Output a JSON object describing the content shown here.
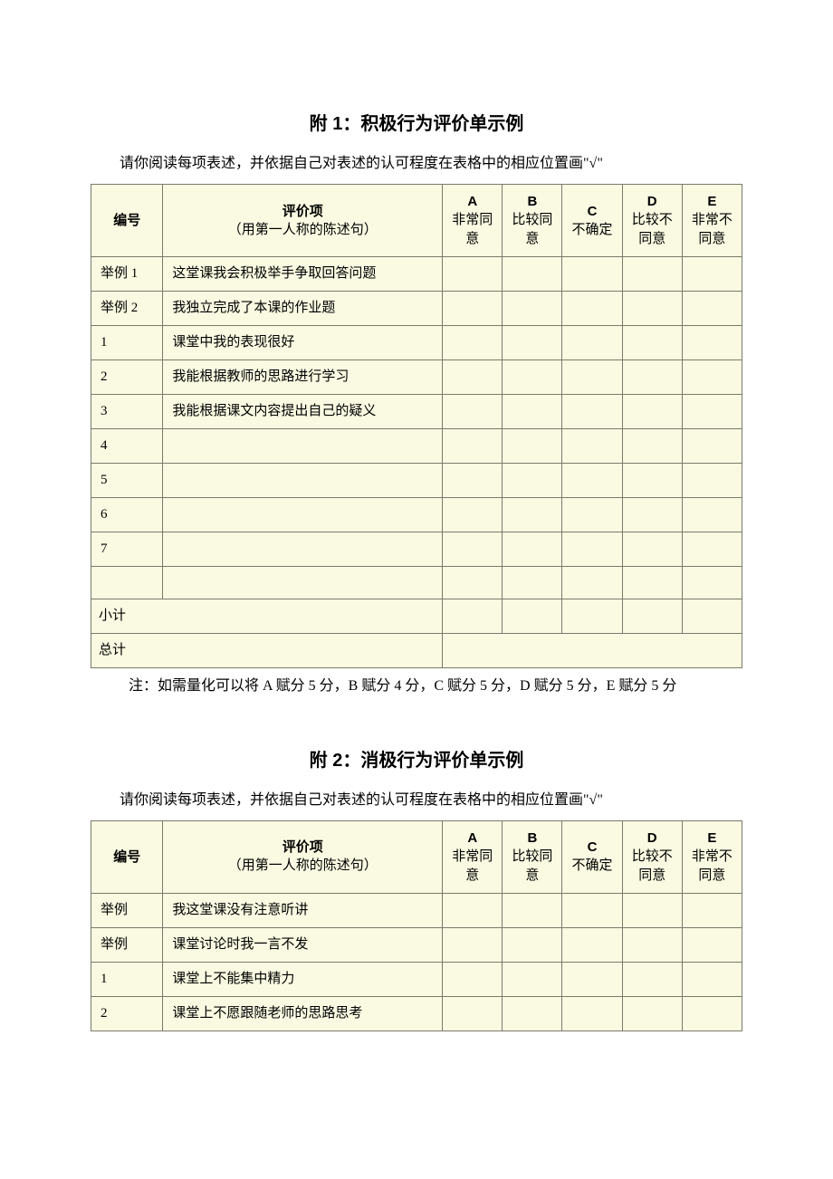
{
  "section1": {
    "title": "附 1：积极行为评价单示例",
    "intro": "请你阅读每项表述，并依据自己对表述的认可程度在表格中的相应位置画\"√\"",
    "headers": {
      "num": "编号",
      "item": "评价项",
      "item_sub": "（用第一人称的陈述句）",
      "a": "A",
      "a_sub": "非常同意",
      "b": "B",
      "b_sub": "比较同意",
      "c": "C",
      "c_sub": "不确定",
      "d": "D",
      "d_sub": "比较不同意",
      "e": "E",
      "e_sub": "非常不同意"
    },
    "rows": [
      {
        "num": "举例 1",
        "desc": "这堂课我会积极举手争取回答问题"
      },
      {
        "num": "举例 2",
        "desc": "我独立完成了本课的作业题"
      },
      {
        "num": "1",
        "desc": "课堂中我的表现很好"
      },
      {
        "num": "2",
        "desc": "我能根据教师的思路进行学习"
      },
      {
        "num": "3",
        "desc": "我能根据课文内容提出自己的疑义"
      },
      {
        "num": "4",
        "desc": ""
      },
      {
        "num": "5",
        "desc": ""
      },
      {
        "num": "6",
        "desc": ""
      },
      {
        "num": "7",
        "desc": ""
      },
      {
        "num": "",
        "desc": ""
      }
    ],
    "subtotal": "小计",
    "total": "总计",
    "note": "注：如需量化可以将 A 赋分 5 分，B 赋分 4 分，C 赋分 5 分，D 赋分 5 分，E 赋分 5 分"
  },
  "section2": {
    "title": "附 2：消极行为评价单示例",
    "intro": "请你阅读每项表述，并依据自己对表述的认可程度在表格中的相应位置画\"√\"",
    "headers": {
      "num": "编号",
      "item": "评价项",
      "item_sub": "（用第一人称的陈述句）",
      "a": "A",
      "a_sub": "非常同意",
      "b": "B",
      "b_sub": "比较同意",
      "c": "C",
      "c_sub": "不确定",
      "d": "D",
      "d_sub": "比较不同意",
      "e": "E",
      "e_sub": "非常不同意"
    },
    "rows": [
      {
        "num": "举例",
        "desc": "我这堂课没有注意听讲"
      },
      {
        "num": "举例",
        "desc": "课堂讨论时我一言不发"
      },
      {
        "num": "1",
        "desc": "课堂上不能集中精力"
      },
      {
        "num": "2",
        "desc": "课堂上不愿跟随老师的思路思考"
      }
    ]
  }
}
